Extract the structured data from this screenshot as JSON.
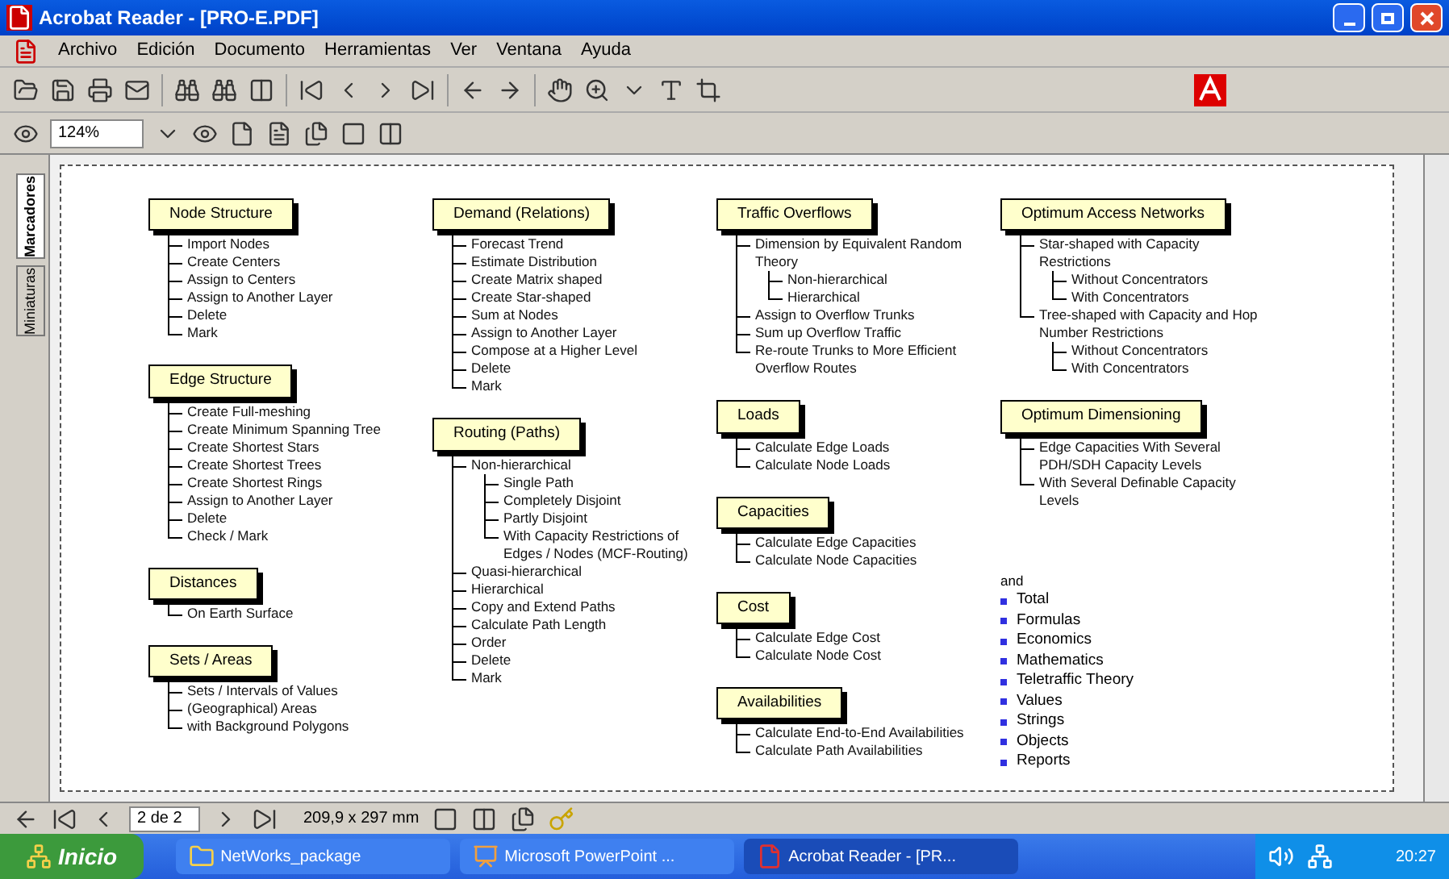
{
  "window": {
    "title": "Acrobat Reader - [PRO-E.PDF]"
  },
  "menu": [
    "Archivo",
    "Edición",
    "Documento",
    "Herramientas",
    "Ver",
    "Ventana",
    "Ayuda"
  ],
  "zoom": {
    "value": "124%"
  },
  "side_tabs": [
    {
      "label": "Marcadores",
      "selected": true
    },
    {
      "label": "Miniaturas",
      "selected": false
    }
  ],
  "columns": [
    {
      "sections": [
        {
          "title": "Node Structure",
          "items": [
            {
              "label": "Import Nodes"
            },
            {
              "label": "Create Centers"
            },
            {
              "label": "Assign to Centers"
            },
            {
              "label": "Assign to Another Layer"
            },
            {
              "label": "Delete"
            },
            {
              "label": "Mark"
            }
          ]
        },
        {
          "title": "Edge Structure",
          "items": [
            {
              "label": "Create Full-meshing"
            },
            {
              "label": "Create Minimum Spanning Tree"
            },
            {
              "label": "Create Shortest Stars"
            },
            {
              "label": "Create Shortest Trees"
            },
            {
              "label": "Create Shortest Rings"
            },
            {
              "label": "Assign to Another Layer"
            },
            {
              "label": "Delete"
            },
            {
              "label": "Check / Mark"
            }
          ]
        },
        {
          "title": "Distances",
          "items": [
            {
              "label": "On Earth Surface"
            }
          ]
        },
        {
          "title": "Sets / Areas",
          "items": [
            {
              "label": "Sets / Intervals of Values"
            },
            {
              "label": "(Geographical) Areas"
            },
            {
              "label": "with Background Polygons"
            }
          ]
        }
      ]
    },
    {
      "sections": [
        {
          "title": "Demand (Relations)",
          "items": [
            {
              "label": "Forecast Trend"
            },
            {
              "label": "Estimate Distribution"
            },
            {
              "label": "Create Matrix shaped"
            },
            {
              "label": "Create Star-shaped"
            },
            {
              "label": "Sum at Nodes"
            },
            {
              "label": "Assign to Another Layer"
            },
            {
              "label": "Compose at a Higher Level"
            },
            {
              "label": "Delete"
            },
            {
              "label": "Mark"
            }
          ]
        },
        {
          "title": "Routing (Paths)",
          "items": [
            {
              "label": "Non-hierarchical",
              "children": [
                {
                  "label": "Single Path"
                },
                {
                  "label": "Completely Disjoint"
                },
                {
                  "label": "Partly Disjoint"
                },
                {
                  "label": "With Capacity Restrictions of Edges / Nodes (MCF-Routing)"
                }
              ]
            },
            {
              "label": "Quasi-hierarchical"
            },
            {
              "label": "Hierarchical"
            },
            {
              "label": "Copy and Extend Paths"
            },
            {
              "label": "Calculate Path Length"
            },
            {
              "label": "Order"
            },
            {
              "label": "Delete"
            },
            {
              "label": "Mark"
            }
          ]
        }
      ]
    },
    {
      "sections": [
        {
          "title": "Traffic Overflows",
          "items": [
            {
              "label": "Dimension by Equivalent Random Theory",
              "children": [
                {
                  "label": "Non-hierarchical"
                },
                {
                  "label": "Hierarchical"
                }
              ]
            },
            {
              "label": "Assign to Overflow Trunks"
            },
            {
              "label": "Sum up Overflow Traffic"
            },
            {
              "label": "Re-route Trunks to More Efficient Overflow Routes"
            }
          ]
        },
        {
          "title": "Loads",
          "items": [
            {
              "label": "Calculate Edge Loads"
            },
            {
              "label": "Calculate Node Loads"
            }
          ]
        },
        {
          "title": "Capacities",
          "items": [
            {
              "label": "Calculate Edge Capacities"
            },
            {
              "label": "Calculate Node Capacities"
            }
          ]
        },
        {
          "title": "Cost",
          "items": [
            {
              "label": "Calculate Edge Cost"
            },
            {
              "label": "Calculate Node Cost"
            }
          ]
        },
        {
          "title": "Availabilities",
          "items": [
            {
              "label": "Calculate End-to-End Availabilities"
            },
            {
              "label": "Calculate Path Availabilities"
            }
          ]
        }
      ]
    },
    {
      "sections": [
        {
          "title": "Optimum Access Networks",
          "items": [
            {
              "label": "Star-shaped with Capacity Restrictions",
              "children": [
                {
                  "label": "Without Concentrators"
                },
                {
                  "label": "With Concentrators"
                }
              ]
            },
            {
              "label": "Tree-shaped with Capacity and Hop Number Restrictions",
              "children": [
                {
                  "label": "Without Concentrators"
                },
                {
                  "label": "With Concentrators"
                }
              ]
            }
          ]
        },
        {
          "title": "Optimum Dimensioning",
          "items": [
            {
              "label": "Edge Capacities With Several PDH/SDH Capacity Levels"
            },
            {
              "label": "With Several Definable Capacity Levels"
            }
          ]
        }
      ],
      "extras": {
        "heading": "and",
        "bullets": [
          "Total",
          "Formulas",
          "Economics",
          "Mathematics",
          "Teletraffic Theory",
          "Values",
          "Strings",
          "Objects",
          "Reports"
        ]
      }
    }
  ],
  "status_bar": {
    "page": "2 de 2",
    "size": "209,9 x 297 mm"
  },
  "taskbar": {
    "start": "Inicio",
    "tasks": [
      {
        "label": "NetWorks_package",
        "selected": false
      },
      {
        "label": "Microsoft PowerPoint ...",
        "selected": false
      },
      {
        "label": "Acrobat Reader - [PR...",
        "selected": true
      }
    ],
    "clock": "20:27"
  }
}
